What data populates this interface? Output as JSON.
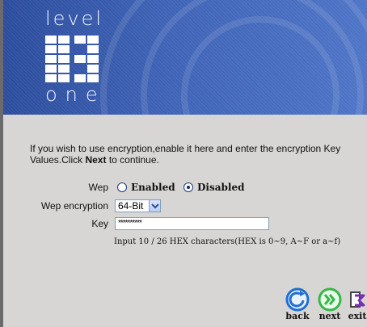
{
  "brand": {
    "logo_top": "level",
    "logo_bottom": "one",
    "logo_mark": "l1"
  },
  "intro": {
    "text_part1": "If you wish to use encryption,enable it here and enter the encryption Key Values.Click ",
    "text_bold": "Next",
    "text_part2": " to continue."
  },
  "wep": {
    "label": "Wep",
    "enabled_label": "Enabled",
    "disabled_label": "Disabled",
    "selected": "Disabled"
  },
  "wep_encryption": {
    "label": "Wep encryption",
    "value": "64-Bit"
  },
  "key": {
    "label": "Key",
    "value": "**********",
    "hint": "Input 10 / 26 HEX characters(HEX is 0~9, A~F or a~f)"
  },
  "nav": {
    "back_label": "back",
    "next_label": "next",
    "exit_label": "exit"
  },
  "colors": {
    "banner_blue": "#3f63b6",
    "background": "#d8d6d4",
    "accent_green": "#39b54a",
    "accent_blue": "#1f6fd1",
    "accent_purple": "#7b2fb6"
  },
  "icons": {
    "back": "back-arrow-icon",
    "next": "next-double-chevron-icon",
    "exit": "exit-icon"
  }
}
